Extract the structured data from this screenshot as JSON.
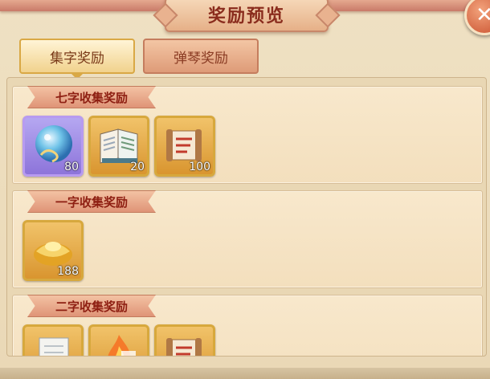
{
  "window": {
    "title": "奖励预览",
    "close_icon": "close-icon"
  },
  "tabs": [
    {
      "label": "集字奖励",
      "active": true
    },
    {
      "label": "弹琴奖励",
      "active": false
    }
  ],
  "sections": [
    {
      "title": "七字收集奖励",
      "items": [
        {
          "icon": "crystal-orb-icon",
          "count": "80",
          "rarity": "purple"
        },
        {
          "icon": "open-book-icon",
          "count": "20",
          "rarity": "gold"
        },
        {
          "icon": "scroll-icon",
          "count": "100",
          "rarity": "gold"
        }
      ]
    },
    {
      "title": "一字收集奖励",
      "items": [
        {
          "icon": "gold-ingot-icon",
          "count": "188",
          "rarity": "gold"
        }
      ]
    },
    {
      "title": "二字收集奖励",
      "items": [
        {
          "icon": "paper-icon",
          "count": "",
          "rarity": "gold"
        },
        {
          "icon": "flame-icon",
          "count": "",
          "rarity": "gold"
        },
        {
          "icon": "scroll-icon",
          "count": "",
          "rarity": "gold"
        }
      ]
    }
  ],
  "colors": {
    "accent": "#8a2c1d",
    "gold_border": "#d7a83d",
    "purple_border": "#b79bf0"
  }
}
